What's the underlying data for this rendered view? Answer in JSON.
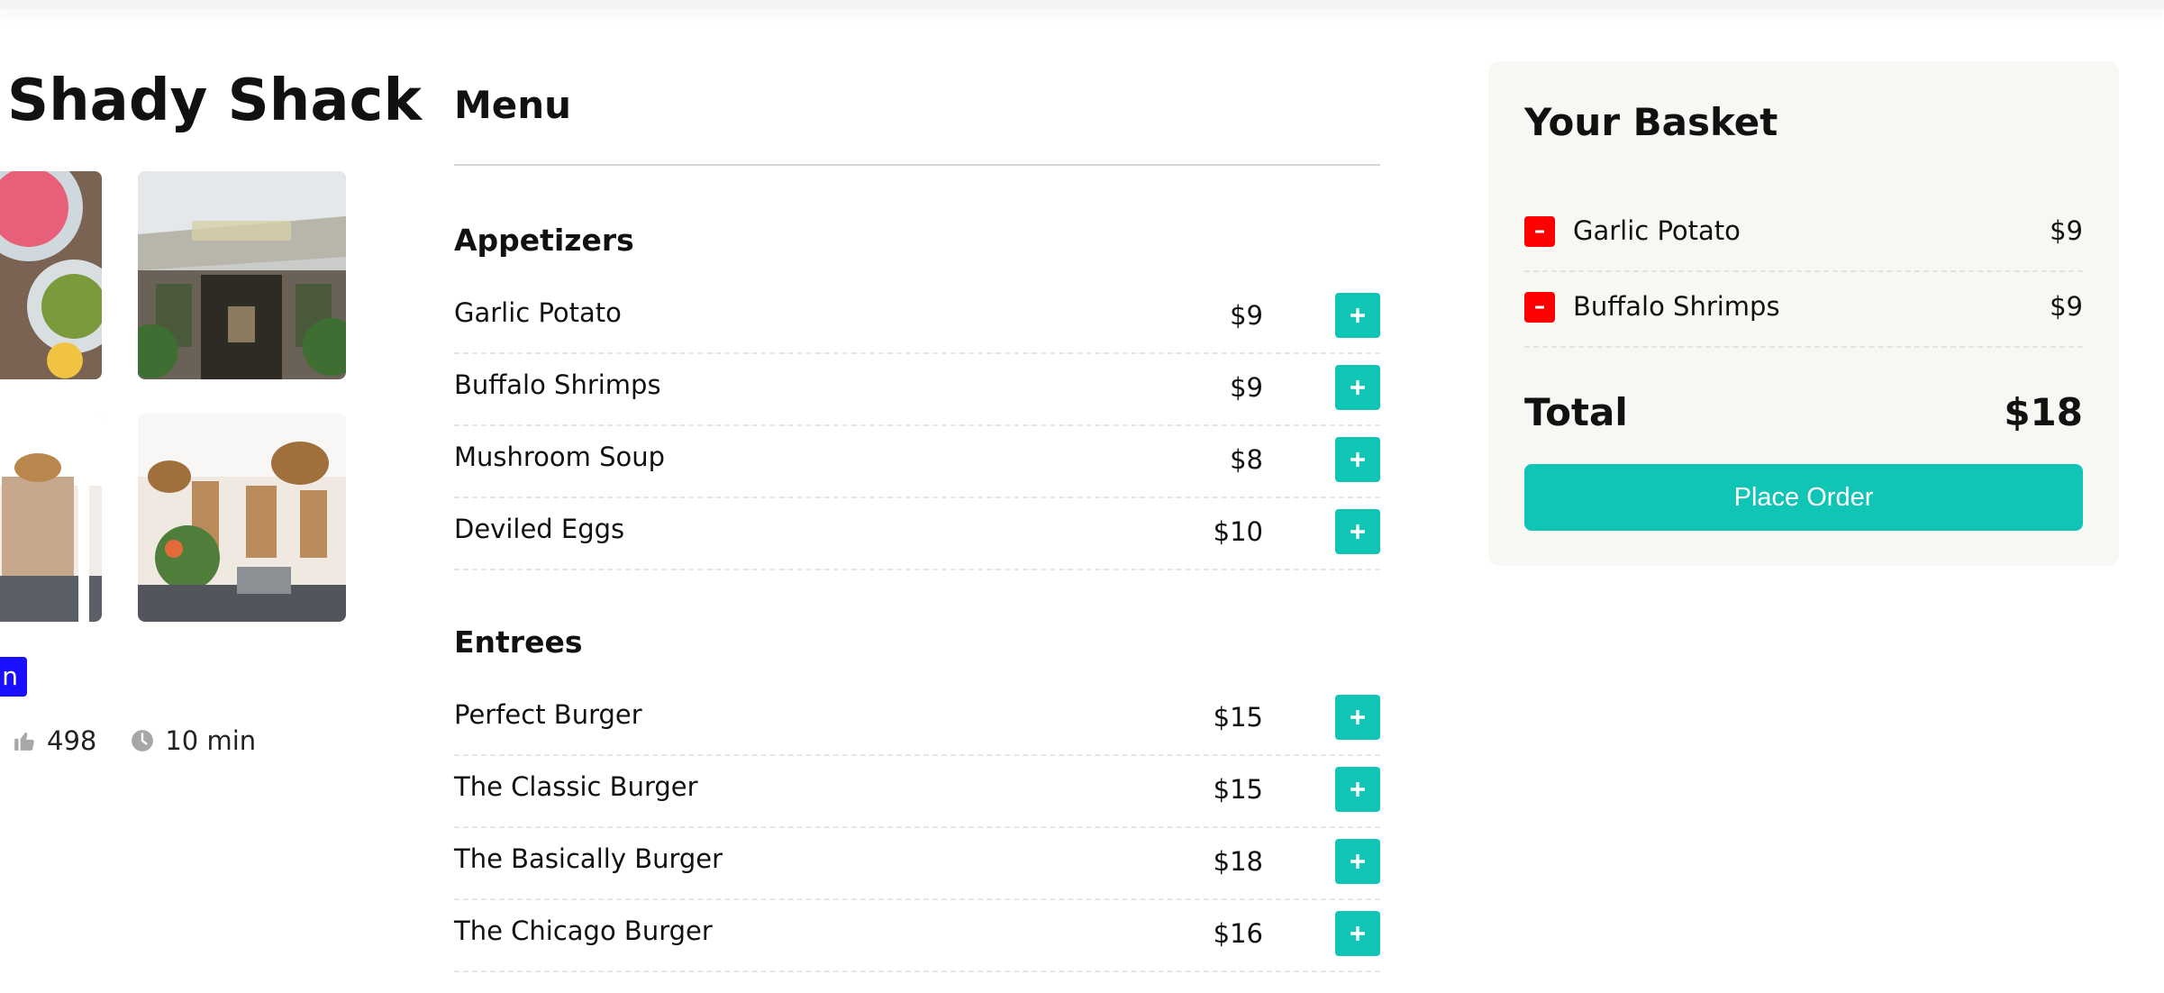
{
  "restaurant": {
    "name": "Shady Shack",
    "tag": "n",
    "likes": "498",
    "delivery_time": "10 min",
    "photos": [
      "food-photo",
      "storefront-photo",
      "interior-photo",
      "dining-room-photo"
    ]
  },
  "menu": {
    "title": "Menu",
    "categories": [
      {
        "title": "Appetizers",
        "items": [
          {
            "name": "Garlic Potato",
            "price": "$9"
          },
          {
            "name": "Buffalo Shrimps",
            "price": "$9"
          },
          {
            "name": "Mushroom Soup",
            "price": "$8"
          },
          {
            "name": "Deviled Eggs",
            "price": "$10"
          }
        ]
      },
      {
        "title": "Entrees",
        "items": [
          {
            "name": "Perfect Burger",
            "price": "$15"
          },
          {
            "name": "The Classic Burger",
            "price": "$15"
          },
          {
            "name": "The Basically Burger",
            "price": "$18"
          },
          {
            "name": "The Chicago Burger",
            "price": "$16"
          }
        ]
      }
    ]
  },
  "basket": {
    "title": "Your Basket",
    "items": [
      {
        "name": "Garlic Potato",
        "price": "$9"
      },
      {
        "name": "Buffalo Shrimps",
        "price": "$9"
      }
    ],
    "total_label": "Total",
    "total_value": "$18",
    "order_label": "Place Order"
  },
  "icons": {
    "add": "plus-icon",
    "remove": "minus-icon",
    "likes": "thumbs-up-icon",
    "time": "clock-icon"
  },
  "colors": {
    "accent": "#10c4b6",
    "remove": "#ff0000",
    "tag": "#1a10ff",
    "basket_bg": "#f7f8f4"
  }
}
